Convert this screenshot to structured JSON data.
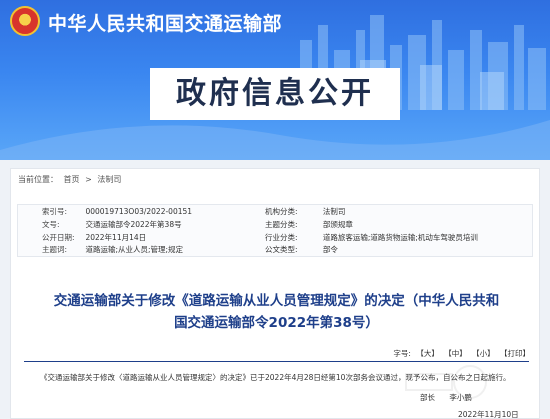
{
  "header": {
    "ministry_name": "中华人民共和国交通运输部",
    "section_title": "政府信息公开"
  },
  "breadcrumb": {
    "prefix": "当前位置：",
    "items": [
      "首页",
      "法制司"
    ],
    "separator": ">"
  },
  "meta": {
    "rows": [
      {
        "k1": "索引号:",
        "v1": "000019713O03/2022-00151",
        "k2": "机构分类:",
        "v2": "法制司"
      },
      {
        "k1": "文号:",
        "v1": "交通运输部令2022年第38号",
        "k2": "主题分类:",
        "v2": "部颁规章"
      },
      {
        "k1": "公开日期:",
        "v1": "2022年11月14日",
        "k2": "行业分类:",
        "v2": "道路旅客运输;道路货物运输;机动车驾驶员培训"
      },
      {
        "k1": "主题词:",
        "v1": "道路运输;从业人员;管理;规定",
        "k2": "公文类型:",
        "v2": "部令"
      }
    ]
  },
  "document": {
    "title_line1": "交通运输部关于修改《道路运输从业人员管理规定》的决定（中华人民共和",
    "title_line2": "国交通运输部令2022年第38号）",
    "body": "《交通运输部关于修改〈道路运输从业人员管理规定〉的决定》已于2022年4月28日经第10次部务会议通过，现予公布，自公布之日起施行。",
    "signer_title": "部长",
    "signer_name": "李小鹏",
    "date": "2022年11月10日"
  },
  "font_tools": {
    "label": "字号:",
    "large": "【大】",
    "medium": "【中】",
    "small": "【小】",
    "print": "【打印】"
  },
  "colors": {
    "banner": "#3a86f0",
    "title": "#1e3f8a"
  }
}
